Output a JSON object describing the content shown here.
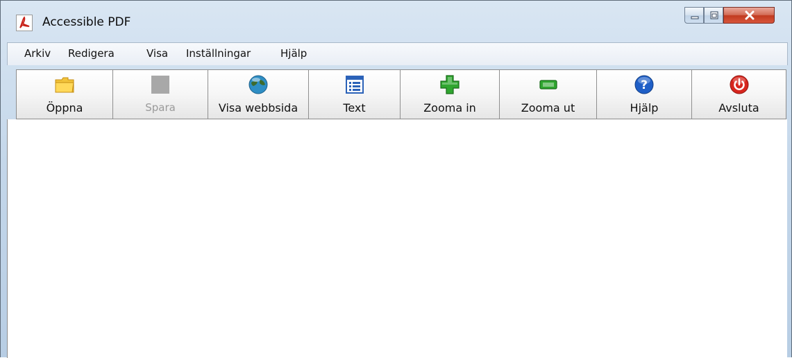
{
  "window": {
    "title": "Accessible PDF",
    "title_icon": "pdf-logo-icon",
    "controls": {
      "minimize_icon": "minimize-icon",
      "maximize_icon": "maximize-icon",
      "close_icon": "close-icon"
    }
  },
  "menubar": {
    "items": [
      {
        "label": "Arkiv"
      },
      {
        "label": "Redigera"
      },
      {
        "label": "Visa"
      },
      {
        "label": "Inställningar"
      },
      {
        "label": "Hjälp"
      }
    ]
  },
  "toolbar": {
    "buttons": [
      {
        "label": "Öppna",
        "icon": "folder-icon",
        "enabled": true
      },
      {
        "label": "Spara",
        "icon": "save-icon",
        "enabled": false
      },
      {
        "label": "Visa webbsida",
        "icon": "globe-icon",
        "enabled": true
      },
      {
        "label": "Text",
        "icon": "text-list-icon",
        "enabled": true
      },
      {
        "label": "Zooma in",
        "icon": "plus-icon",
        "enabled": true
      },
      {
        "label": "Zooma ut",
        "icon": "minus-icon",
        "enabled": true
      },
      {
        "label": "Hjälp",
        "icon": "help-icon",
        "enabled": true
      },
      {
        "label": "Avsluta",
        "icon": "power-icon",
        "enabled": true
      }
    ]
  },
  "colors": {
    "close_button": "#c7462c",
    "plus_green": "#2fa62f",
    "help_blue": "#1f5fc7",
    "power_red": "#d7261e"
  }
}
